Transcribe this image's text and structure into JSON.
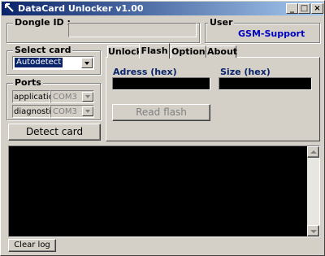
{
  "titlebar": {
    "title": "DataCard Unlocker v1.00",
    "app_icon": "diagonal-arrow-icon",
    "minimize": "_",
    "maximize": "□",
    "close": "×"
  },
  "dongle": {
    "label": "Dongle ID :",
    "value": ""
  },
  "user": {
    "label": "User",
    "value": "GSM-Support",
    "value_color": "#0000c0"
  },
  "select_card": {
    "label": "Select card",
    "selected": "Autodetect"
  },
  "ports": {
    "label": "Ports",
    "application": {
      "label": "application",
      "value": "COM3"
    },
    "diagnostic": {
      "label": "diagnostic",
      "value": "COM3"
    }
  },
  "detect_button": "Detect card",
  "tabs": [
    {
      "label": "Unlock",
      "active": false
    },
    {
      "label": "Flash",
      "active": true
    },
    {
      "label": "Options",
      "active": false
    },
    {
      "label": "About",
      "active": false
    }
  ],
  "flash": {
    "address_label": "Adress (hex)",
    "address_value": "",
    "size_label": "Size (hex)",
    "size_value": "",
    "read_button": "Read flash",
    "label_color": "#0a246a"
  },
  "log": {
    "content": ""
  },
  "clear_log": "Clear log"
}
